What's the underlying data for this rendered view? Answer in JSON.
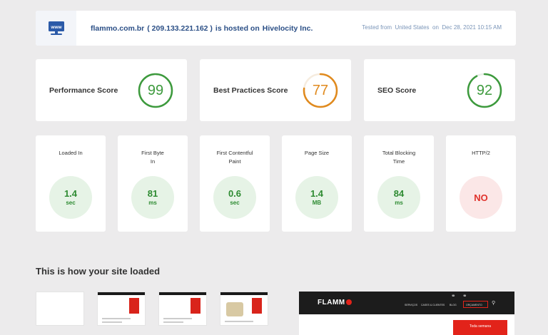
{
  "header": {
    "domain": "flammo.com.br",
    "ip": "( 209.133.221.162 )",
    "hosted_text": "is hosted on",
    "host": "Hivelocity Inc.",
    "tested_from_label": "Tested from",
    "location": "United States",
    "on_label": "on",
    "date": "Dec 28, 2021 10:15 AM",
    "icon": "www-monitor-icon",
    "icon_text": "www"
  },
  "scores": [
    {
      "label": "Performance Score",
      "value": "99",
      "percent": 99,
      "color": "#3d9a3d"
    },
    {
      "label": "Best Practices Score",
      "value": "77",
      "percent": 77,
      "color": "#e08a1e"
    },
    {
      "label": "SEO Score",
      "value": "92",
      "percent": 92,
      "color": "#3d9a3d"
    }
  ],
  "metrics": [
    {
      "label_1": "Loaded In",
      "label_2": "",
      "value": "1.4",
      "unit": "sec"
    },
    {
      "label_1": "First Byte",
      "label_2": "In",
      "value": "81",
      "unit": "ms"
    },
    {
      "label_1": "First Contentful",
      "label_2": "Paint",
      "value": "0.6",
      "unit": "sec"
    },
    {
      "label_1": "Page Size",
      "label_2": "",
      "value": "1.4",
      "unit": "MB"
    },
    {
      "label_1": "Total Blocking",
      "label_2": "Time",
      "value": "84",
      "unit": "ms"
    },
    {
      "label_1": "HTTP/2",
      "label_2": "",
      "value": "NO",
      "unit": ""
    }
  ],
  "colors": {
    "good": "#2e8b32",
    "bad": "#e0322c",
    "accent": "#2b4f86"
  },
  "filmstrip": {
    "title": "This is how your site loaded"
  },
  "preview": {
    "logo": "FLAMM",
    "nav": [
      "SERVIÇOS",
      "CASES & CLIENTES",
      "BLOG",
      "ORÇAMENTO"
    ],
    "red_label": "Toda semana"
  }
}
